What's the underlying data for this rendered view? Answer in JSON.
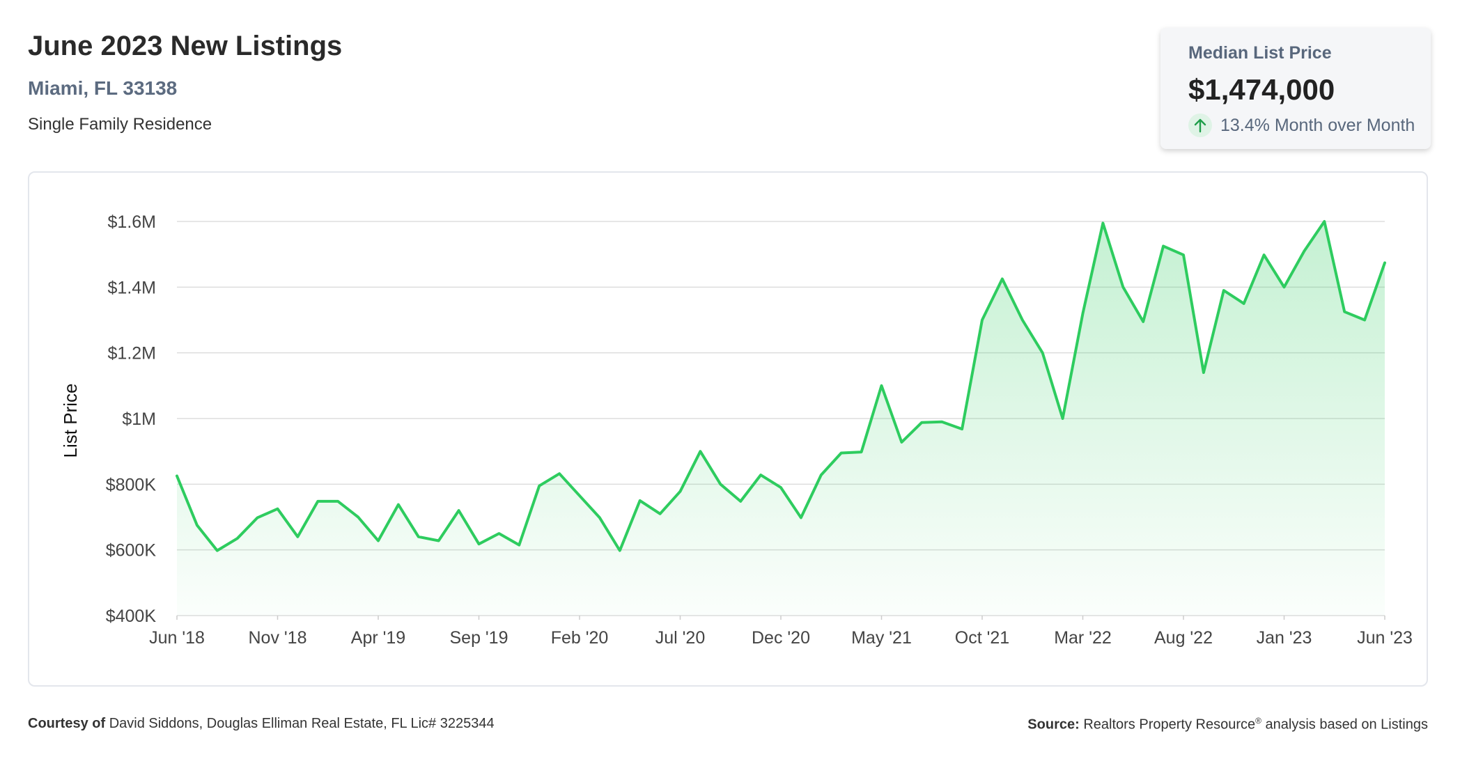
{
  "header": {
    "title": "June 2023 New Listings",
    "location": "Miami, FL 33138",
    "property_type": "Single Family Residence"
  },
  "kpi": {
    "label": "Median List Price",
    "value": "$1,474,000",
    "change": "13.4% Month over Month",
    "direction_icon": "arrow-up-icon",
    "accent_color": "#1f9e4a"
  },
  "footer": {
    "courtesy_label": "Courtesy of",
    "courtesy_text": "David Siddons, Douglas Elliman Real Estate, FL Lic# 3225344",
    "source_label": "Source:",
    "source_text_1": "Realtors Property Resource",
    "source_mark": "®",
    "source_text_2": "analysis based on Listings"
  },
  "chart_data": {
    "type": "area",
    "title": "",
    "xlabel": "",
    "ylabel": "List Price",
    "ylim": [
      400000,
      1600000
    ],
    "y_ticks": [
      400000,
      600000,
      800000,
      1000000,
      1200000,
      1400000,
      1600000
    ],
    "y_tick_labels": [
      "$400K",
      "$600K",
      "$800K",
      "$1M",
      "$1.2M",
      "$1.4M",
      "$1.6M"
    ],
    "x_tick_labels": [
      "Jun '18",
      "Nov '18",
      "Apr '19",
      "Sep '19",
      "Feb '20",
      "Jul '20",
      "Dec '20",
      "May '21",
      "Oct '21",
      "Mar '22",
      "Aug '22",
      "Jan '23",
      "Jun '23"
    ],
    "x_tick_index": [
      0,
      5,
      10,
      15,
      20,
      25,
      30,
      35,
      40,
      45,
      50,
      55,
      60
    ],
    "grid": true,
    "line_color": "#2ecc5f",
    "fill_color": "#2ecc5f",
    "series": [
      {
        "name": "",
        "values": [
          825000,
          675000,
          598000,
          635000,
          698000,
          725000,
          640000,
          748000,
          748000,
          700000,
          628000,
          738000,
          640000,
          628000,
          720000,
          618000,
          650000,
          615000,
          795000,
          832000,
          765000,
          698000,
          598000,
          750000,
          710000,
          778000,
          900000,
          800000,
          748000,
          828000,
          790000,
          698000,
          828000,
          895000,
          898000,
          1100000,
          928000,
          988000,
          990000,
          968000,
          1300000,
          1425000,
          1300000,
          1200000,
          1000000,
          1320000,
          1595000,
          1400000,
          1295000,
          1525000,
          1498000,
          1140000,
          1390000,
          1350000,
          1498000,
          1400000,
          1510000,
          1600000,
          1325000,
          1300000,
          1474000
        ]
      }
    ]
  }
}
